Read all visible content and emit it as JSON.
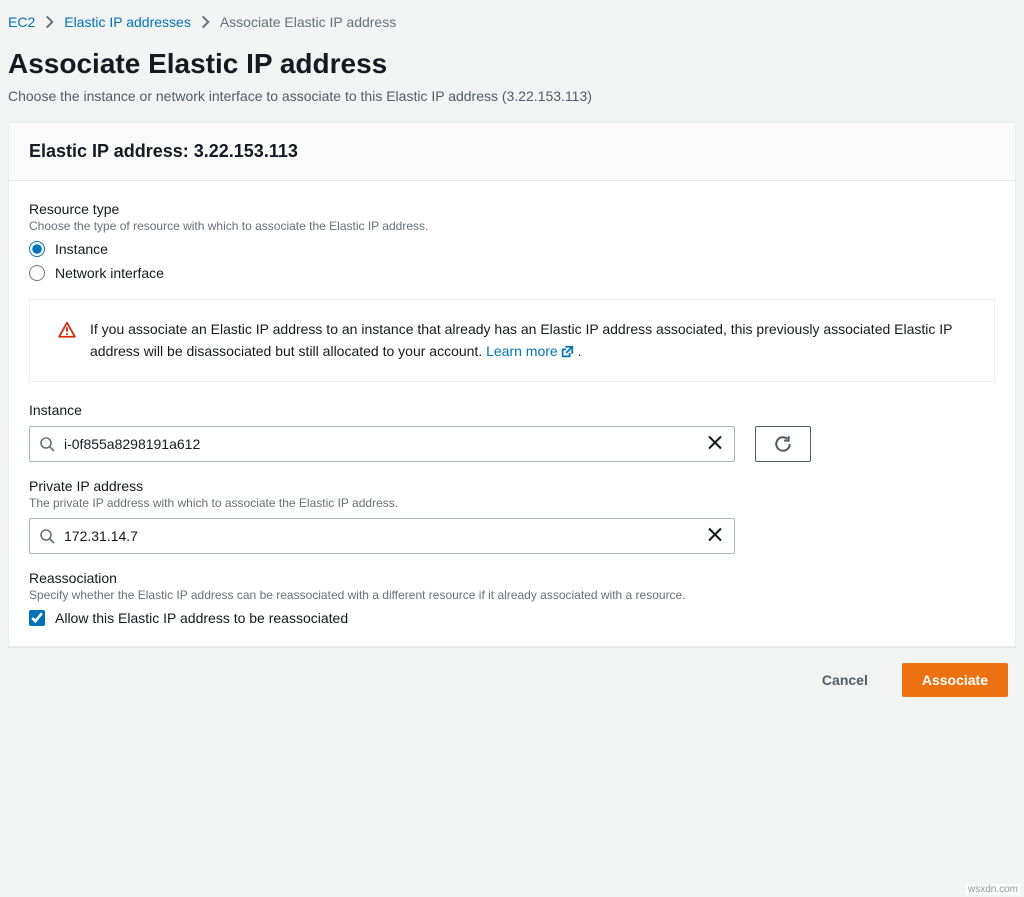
{
  "breadcrumb": {
    "items": [
      "EC2",
      "Elastic IP addresses",
      "Associate Elastic IP address"
    ]
  },
  "page": {
    "title": "Associate Elastic IP address",
    "description": "Choose the instance or network interface to associate to this Elastic IP address (3.22.153.113)"
  },
  "panel": {
    "header": "Elastic IP address: 3.22.153.113"
  },
  "resourceType": {
    "label": "Resource type",
    "help": "Choose the type of resource with which to associate the Elastic IP address.",
    "options": {
      "instance": "Instance",
      "networkInterface": "Network interface"
    },
    "selected": "instance"
  },
  "warning": {
    "text": "If you associate an Elastic IP address to an instance that already has an Elastic IP address associated, this previously associated Elastic IP address will be disassociated but still allocated to your account. ",
    "learnMore": "Learn more",
    "trailing": "."
  },
  "instance": {
    "label": "Instance",
    "value": "i-0f855a8298191a612"
  },
  "privateIp": {
    "label": "Private IP address",
    "help": "The private IP address with which to associate the Elastic IP address.",
    "value": "172.31.14.7"
  },
  "reassociation": {
    "label": "Reassociation",
    "help": "Specify whether the Elastic IP address can be reassociated with a different resource if it already associated with a resource.",
    "checkboxLabel": "Allow this Elastic IP address to be reassociated",
    "checked": true
  },
  "actions": {
    "cancel": "Cancel",
    "associate": "Associate"
  },
  "watermark": "wsxdn.com"
}
